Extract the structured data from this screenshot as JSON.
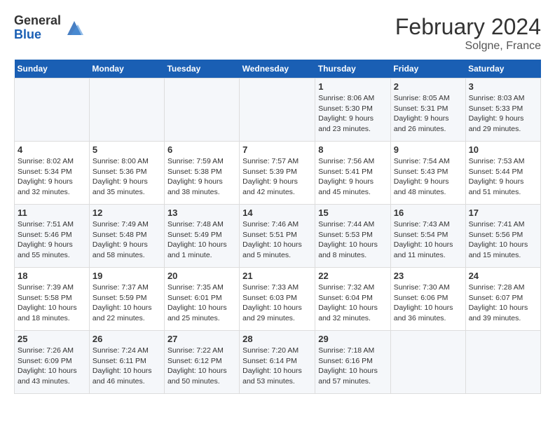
{
  "header": {
    "logo": {
      "general": "General",
      "blue": "Blue"
    },
    "title": "February 2024",
    "location": "Solgne, France"
  },
  "weekdays": [
    "Sunday",
    "Monday",
    "Tuesday",
    "Wednesday",
    "Thursday",
    "Friday",
    "Saturday"
  ],
  "weeks": [
    [
      {
        "day": "",
        "info": ""
      },
      {
        "day": "",
        "info": ""
      },
      {
        "day": "",
        "info": ""
      },
      {
        "day": "",
        "info": ""
      },
      {
        "day": "1",
        "info": "Sunrise: 8:06 AM\nSunset: 5:30 PM\nDaylight: 9 hours\nand 23 minutes."
      },
      {
        "day": "2",
        "info": "Sunrise: 8:05 AM\nSunset: 5:31 PM\nDaylight: 9 hours\nand 26 minutes."
      },
      {
        "day": "3",
        "info": "Sunrise: 8:03 AM\nSunset: 5:33 PM\nDaylight: 9 hours\nand 29 minutes."
      }
    ],
    [
      {
        "day": "4",
        "info": "Sunrise: 8:02 AM\nSunset: 5:34 PM\nDaylight: 9 hours\nand 32 minutes."
      },
      {
        "day": "5",
        "info": "Sunrise: 8:00 AM\nSunset: 5:36 PM\nDaylight: 9 hours\nand 35 minutes."
      },
      {
        "day": "6",
        "info": "Sunrise: 7:59 AM\nSunset: 5:38 PM\nDaylight: 9 hours\nand 38 minutes."
      },
      {
        "day": "7",
        "info": "Sunrise: 7:57 AM\nSunset: 5:39 PM\nDaylight: 9 hours\nand 42 minutes."
      },
      {
        "day": "8",
        "info": "Sunrise: 7:56 AM\nSunset: 5:41 PM\nDaylight: 9 hours\nand 45 minutes."
      },
      {
        "day": "9",
        "info": "Sunrise: 7:54 AM\nSunset: 5:43 PM\nDaylight: 9 hours\nand 48 minutes."
      },
      {
        "day": "10",
        "info": "Sunrise: 7:53 AM\nSunset: 5:44 PM\nDaylight: 9 hours\nand 51 minutes."
      }
    ],
    [
      {
        "day": "11",
        "info": "Sunrise: 7:51 AM\nSunset: 5:46 PM\nDaylight: 9 hours\nand 55 minutes."
      },
      {
        "day": "12",
        "info": "Sunrise: 7:49 AM\nSunset: 5:48 PM\nDaylight: 9 hours\nand 58 minutes."
      },
      {
        "day": "13",
        "info": "Sunrise: 7:48 AM\nSunset: 5:49 PM\nDaylight: 10 hours\nand 1 minute."
      },
      {
        "day": "14",
        "info": "Sunrise: 7:46 AM\nSunset: 5:51 PM\nDaylight: 10 hours\nand 5 minutes."
      },
      {
        "day": "15",
        "info": "Sunrise: 7:44 AM\nSunset: 5:53 PM\nDaylight: 10 hours\nand 8 minutes."
      },
      {
        "day": "16",
        "info": "Sunrise: 7:43 AM\nSunset: 5:54 PM\nDaylight: 10 hours\nand 11 minutes."
      },
      {
        "day": "17",
        "info": "Sunrise: 7:41 AM\nSunset: 5:56 PM\nDaylight: 10 hours\nand 15 minutes."
      }
    ],
    [
      {
        "day": "18",
        "info": "Sunrise: 7:39 AM\nSunset: 5:58 PM\nDaylight: 10 hours\nand 18 minutes."
      },
      {
        "day": "19",
        "info": "Sunrise: 7:37 AM\nSunset: 5:59 PM\nDaylight: 10 hours\nand 22 minutes."
      },
      {
        "day": "20",
        "info": "Sunrise: 7:35 AM\nSunset: 6:01 PM\nDaylight: 10 hours\nand 25 minutes."
      },
      {
        "day": "21",
        "info": "Sunrise: 7:33 AM\nSunset: 6:03 PM\nDaylight: 10 hours\nand 29 minutes."
      },
      {
        "day": "22",
        "info": "Sunrise: 7:32 AM\nSunset: 6:04 PM\nDaylight: 10 hours\nand 32 minutes."
      },
      {
        "day": "23",
        "info": "Sunrise: 7:30 AM\nSunset: 6:06 PM\nDaylight: 10 hours\nand 36 minutes."
      },
      {
        "day": "24",
        "info": "Sunrise: 7:28 AM\nSunset: 6:07 PM\nDaylight: 10 hours\nand 39 minutes."
      }
    ],
    [
      {
        "day": "25",
        "info": "Sunrise: 7:26 AM\nSunset: 6:09 PM\nDaylight: 10 hours\nand 43 minutes."
      },
      {
        "day": "26",
        "info": "Sunrise: 7:24 AM\nSunset: 6:11 PM\nDaylight: 10 hours\nand 46 minutes."
      },
      {
        "day": "27",
        "info": "Sunrise: 7:22 AM\nSunset: 6:12 PM\nDaylight: 10 hours\nand 50 minutes."
      },
      {
        "day": "28",
        "info": "Sunrise: 7:20 AM\nSunset: 6:14 PM\nDaylight: 10 hours\nand 53 minutes."
      },
      {
        "day": "29",
        "info": "Sunrise: 7:18 AM\nSunset: 6:16 PM\nDaylight: 10 hours\nand 57 minutes."
      },
      {
        "day": "",
        "info": ""
      },
      {
        "day": "",
        "info": ""
      }
    ]
  ]
}
